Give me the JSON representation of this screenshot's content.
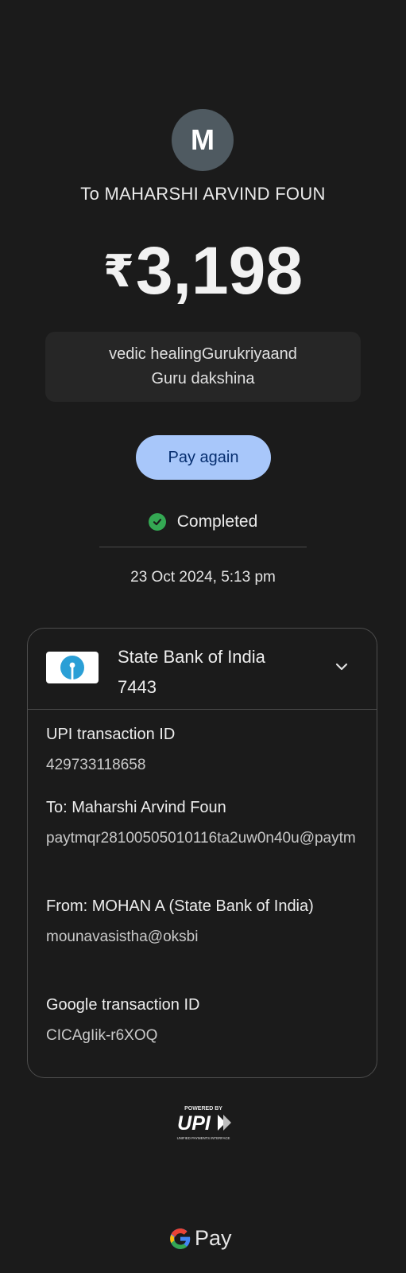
{
  "avatar": {
    "initial": "M"
  },
  "recipient": {
    "title": "To MAHARSHI ARVIND FOUN"
  },
  "amount": {
    "currency": "₹",
    "value": "3,198"
  },
  "note": {
    "line1": "vedic healingGurukriyaand",
    "line2": "Guru dakshina"
  },
  "actions": {
    "pay_again_label": "Pay again"
  },
  "status": {
    "label": "Completed",
    "icon": "check-circle-icon",
    "color": "#34a853"
  },
  "datetime": "23 Oct 2024, 5:13 pm",
  "bank": {
    "name": "State Bank of India",
    "account_suffix": "7443",
    "logo_color": "#2a9fd6"
  },
  "details": {
    "upi_label": "UPI transaction ID",
    "upi_value": "429733118658",
    "to_label": "To: Maharshi Arvind Foun",
    "to_value": "paytmqr28100505010116ta2uw0n40u@paytm",
    "from_label": "From: MOHAN  A (State Bank of India)",
    "from_value": "mounavasistha@oksbi",
    "google_label": "Google transaction ID",
    "google_value": "CICAgIik-r6XOQ"
  },
  "branding": {
    "upi_powered_by": "POWERED BY",
    "upi_logo_text": "UPI",
    "upi_tagline": "UNIFIED PAYMENTS INTERFACE",
    "gpay_text": "Pay"
  },
  "colors": {
    "background": "#1b1b1b",
    "accent_button": "#a8c7fa",
    "button_text": "#062e6f"
  }
}
